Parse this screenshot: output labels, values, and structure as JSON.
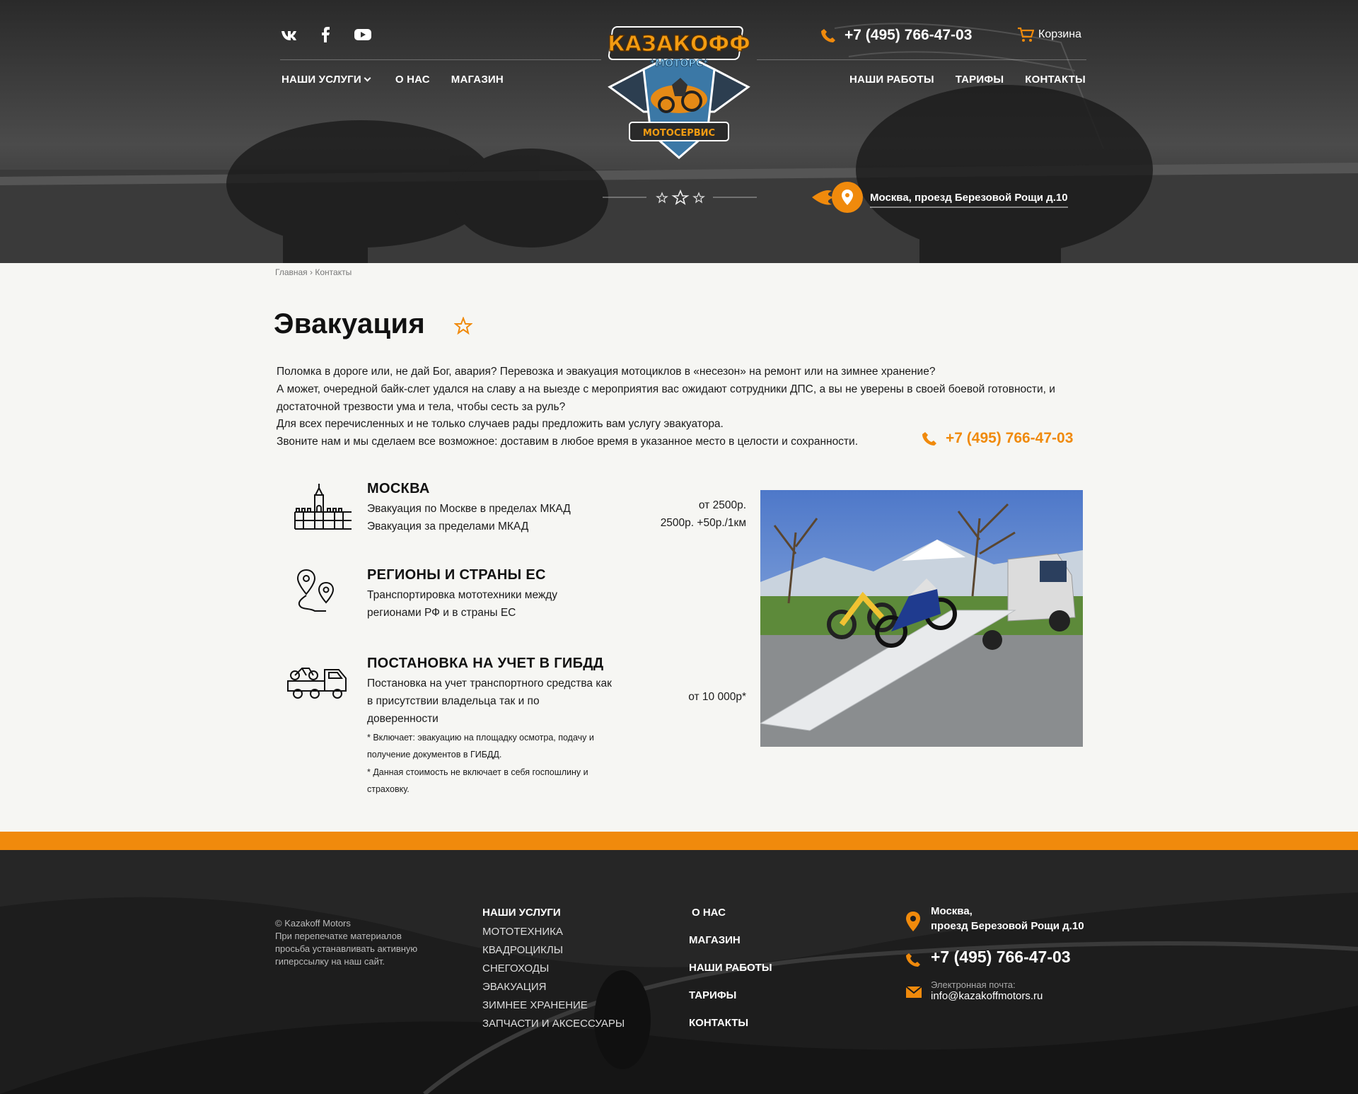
{
  "header": {
    "social": [
      "vk-icon",
      "facebook-icon",
      "youtube-icon"
    ],
    "nav_left": [
      {
        "label": "НАШИ УСЛУГИ"
      },
      {
        "label": "О НАС"
      },
      {
        "label": "МАГАЗИН"
      }
    ],
    "nav_right": [
      {
        "label": "НАШИ РАБОТЫ"
      },
      {
        "label": "ТАРИФЫ"
      },
      {
        "label": "КОНТАКТЫ"
      }
    ],
    "phone": "+7 (495) 766-47-03",
    "cart_label": "Корзина",
    "address": "Москва, проезд Березовой Рощи д.10",
    "logo": {
      "brand": "КАЗАКОФФ",
      "sub": "*МОТОРС*",
      "tag": "МОТОСЕРВИС"
    }
  },
  "breadcrumb": {
    "home": "Главная",
    "separator": "›",
    "current": "Контакты"
  },
  "page": {
    "title": "Эвакуация",
    "intro": [
      "Поломка в дороге или, не дай Бог, авария? Перевозка и эвакуация мотоциклов в «несезон» на ремонт или на зимнее хранение?",
      "А может, очередной байк-слет удался на славу а на выезде с мероприятия вас ожидают сотрудники ДПС, а вы не уверены в своей боевой готовности, и",
      "достаточной трезвости ума и тела, чтобы сесть за руль?",
      "Для всех перечисленных и не только случаев рады предложить вам услугу эвакуатора.",
      "Звоните нам и мы сделаем все возможное: доставим в любое время в указанное место в целости и сохранности."
    ],
    "phone": "+7 (495) 766-47-03"
  },
  "services": [
    {
      "icon": "kremlin-icon",
      "name": "МОСКВА",
      "lines": [
        "Эвакуация по Москве в пределах МКАД",
        "Эвакуация за пределами МКАД"
      ],
      "prices": [
        "от 2500р.",
        "2500р. +50р./1км"
      ]
    },
    {
      "icon": "route-pins-icon",
      "name": "РЕГИОНЫ И СТРАНЫ ЕС",
      "lines": [
        "Транспортировка мототехники между",
        "регионами РФ и в страны ЕС"
      ],
      "prices": []
    },
    {
      "icon": "tow-truck-icon",
      "name": "ПОСТАНОВКА НА УЧЕТ В ГИБДД",
      "lines": [
        "Постановка на учет транспортного средства как",
        "в присутствии владельца так и по",
        "доверенности"
      ],
      "prices": [
        "от 10 000р*"
      ],
      "notes": [
        "* Включает: эвакуацию на площадку осмотра, подачу и",
        "получение документов в  ГИБДД.",
        "* Данная стоимость не включает в себя госпошлину и",
        "страховку."
      ]
    }
  ],
  "footer": {
    "copyright": "© Kazakoff Motors",
    "copy_note": [
      "При перепечатке материалов",
      "просьба устанавливать активную",
      "гиперссылку на наш сайт."
    ],
    "services_heading": "НАШИ УСЛУГИ",
    "services": [
      "МОТОТЕХНИКА",
      "КВАДРОЦИКЛЫ",
      "СНЕГОХОДЫ",
      "ЭВАКУАЦИЯ",
      "ЗИМНЕЕ ХРАНЕНИЕ",
      "ЗАПЧАСТИ И АКСЕССУАРЫ"
    ],
    "pages": [
      "О НАС",
      "МАГАЗИН",
      "НАШИ РАБОТЫ",
      "ТАРИФЫ",
      "КОНТАКТЫ"
    ],
    "address_line1": "Москва,",
    "address_line2": "проезд Березовой Рощи д.10",
    "phone": "+7 (495) 766-47-03",
    "email_label": "Электронная почта:",
    "email": "info@kazakoffmotors.ru"
  },
  "colors": {
    "accent": "#f08a0c",
    "dark": "#1c1c1c",
    "background": "#f6f6f3"
  }
}
